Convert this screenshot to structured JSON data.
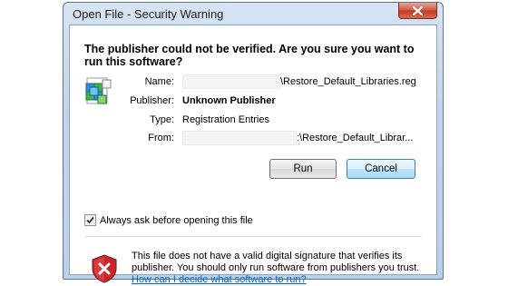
{
  "window": {
    "title": "Open File - Security Warning"
  },
  "dialog": {
    "headline": "The publisher could not be verified.  Are you sure you want to run this software?",
    "fields": {
      "name_label": "Name:",
      "name_value": "\\Restore_Default_Libraries.reg",
      "publisher_label": "Publisher:",
      "publisher_value": "Unknown Publisher",
      "type_label": "Type:",
      "type_value": "Registration Entries",
      "from_label": "From:",
      "from_value": ":\\Restore_Default_Librar..."
    },
    "buttons": {
      "run_label": "Run",
      "cancel_label": "Cancel"
    },
    "checkbox": {
      "label": "Always ask before opening this file",
      "checked": true
    },
    "warning": {
      "text": "This file does not have a valid digital signature that verifies its publisher.  You should only run software from publishers you trust.",
      "link": "How can I decide what software to run?"
    }
  },
  "icons": {
    "close": "close-icon",
    "file": "registry-file-icon",
    "shield": "shield-warning-icon",
    "check": "checkmark-icon"
  },
  "colors": {
    "close_button": "#c23a23",
    "link": "#0066cc",
    "shield_red": "#c8262b",
    "default_button_border": "#3c7fb1"
  }
}
